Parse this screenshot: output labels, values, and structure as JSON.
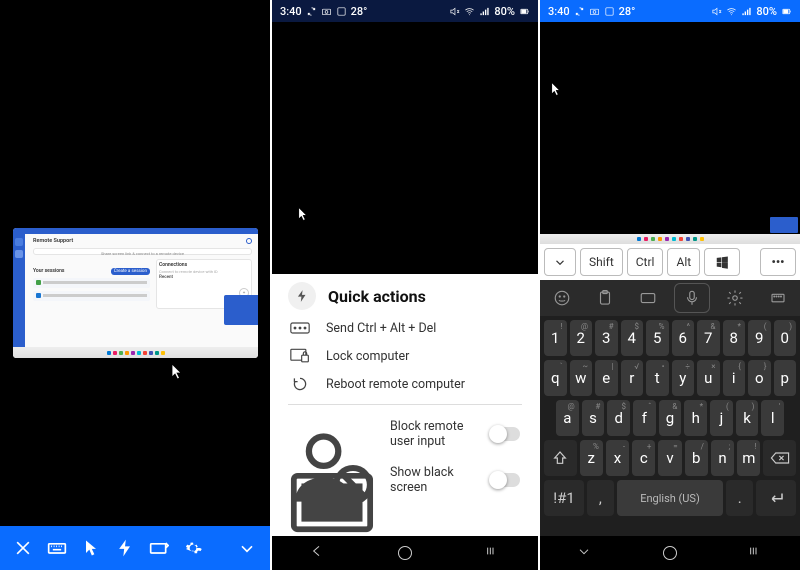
{
  "statusbar": {
    "time": "3:40",
    "battery": "80%",
    "temp": "28°"
  },
  "panel1": {
    "remote_support_title": "Remote Support",
    "sessions_label": "Your sessions",
    "connections_label": "Connections",
    "create_button": "Create a session",
    "recent_label": "Recent"
  },
  "bottom_toolbar": {},
  "quick_actions": {
    "title": "Quick actions",
    "items": [
      "Send Ctrl + Alt + Del",
      "Lock computer",
      "Reboot remote computer"
    ],
    "toggles": [
      "Block remote user input",
      "Show black screen"
    ]
  },
  "modifier_row": {
    "shift": "Shift",
    "ctrl": "Ctrl",
    "alt": "Alt"
  },
  "keyboard": {
    "num_row": [
      "1",
      "2",
      "3",
      "4",
      "5",
      "6",
      "7",
      "8",
      "9",
      "0"
    ],
    "num_syms": [
      "!",
      "@",
      "#",
      "$",
      "%",
      "^",
      "&",
      "*",
      "(",
      ")"
    ],
    "row1": [
      "q",
      "w",
      "e",
      "r",
      "t",
      "y",
      "u",
      "i",
      "o",
      "p"
    ],
    "row1_syms": [
      "`",
      "~",
      "|",
      "√",
      "•",
      "÷",
      "×",
      "{",
      "}",
      ""
    ],
    "row2": [
      "a",
      "s",
      "d",
      "f",
      "g",
      "h",
      "j",
      "k",
      "l"
    ],
    "row2_syms": [
      "@",
      "#",
      "$",
      "ˆ",
      "&",
      "*",
      "(",
      ")",
      "'"
    ],
    "row3": [
      "z",
      "x",
      "c",
      "v",
      "b",
      "n",
      "m"
    ],
    "row3_syms": [
      "%",
      "-",
      "+",
      "=",
      "/",
      ";",
      "!"
    ],
    "sym_key": "!#1",
    "space_label": "English (US)",
    "comma": ",",
    "period": "."
  }
}
